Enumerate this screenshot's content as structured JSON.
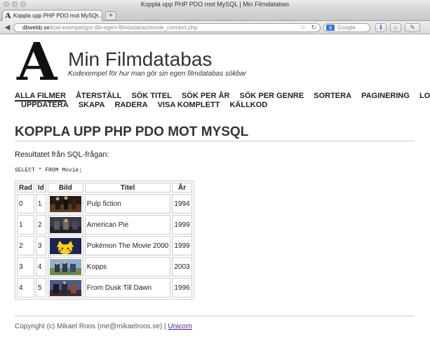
{
  "window": {
    "title": "Koppla upp PHP PDO mot MySQL | Min Filmdatabas"
  },
  "tab": {
    "label": "Koppla upp PHP PDO mot MySQ...",
    "close": "×",
    "new_tab": "+"
  },
  "toolbar": {
    "back": "◀",
    "url_domain": "dbwebb.se",
    "url_path": "/kod-exempel/gor-din-egen-filmdatabas/movie_connect.php",
    "bookmark_star": "☆",
    "reload": "↻",
    "search_engine": "g",
    "search_placeholder": "Google",
    "download": "⬇",
    "home": "⌂",
    "tools": "✎"
  },
  "site": {
    "logo_letter": "A",
    "title": "Min Filmdatabas",
    "slogan": "Kodexempel för hur man gör sin egen filmdatabas sökbar"
  },
  "menu": {
    "row1": [
      "ALLA FILMER",
      "ÅTERSTÄLL",
      "SÖK TITEL",
      "SÖK PER ÅR",
      "SÖK PER GENRE",
      "SORTERA",
      "PAGINERING",
      "LOGIN"
    ],
    "row2": [
      "UPPDATERA",
      "SKAPA",
      "RADERA",
      "VISA KOMPLETT",
      "KÄLLKOD"
    ],
    "selected": "ALLA FILMER"
  },
  "main": {
    "heading": "KOPPLA UPP PHP PDO MOT MYSQL",
    "intro": "Resultatet från SQL-frågan:",
    "sql": "SELECT * FROM Movie;"
  },
  "table": {
    "headers": [
      "Rad",
      "Id",
      "Bild",
      "Titel",
      "År"
    ],
    "rows": [
      {
        "rad": "0",
        "id": "1",
        "thumb_icon": "pulp-fiction-thumb",
        "titel": "Pulp fiction",
        "ar": "1994"
      },
      {
        "rad": "1",
        "id": "2",
        "thumb_icon": "american-pie-thumb",
        "titel": "American Pie",
        "ar": "1999"
      },
      {
        "rad": "2",
        "id": "3",
        "thumb_icon": "pokemon-thumb",
        "titel": "Pokémon The Movie 2000",
        "ar": "1999"
      },
      {
        "rad": "3",
        "id": "4",
        "thumb_icon": "kopps-thumb",
        "titel": "Kopps",
        "ar": "2003"
      },
      {
        "rad": "4",
        "id": "5",
        "thumb_icon": "from-dusk-thumb",
        "titel": "From Dusk Till Dawn",
        "ar": "1996"
      }
    ]
  },
  "footer": {
    "text": "Copyright (c) Mikael Roos (me@mikaelroos.se) |",
    "link": "Unicorn"
  },
  "colors": {
    "link_visited": "#551a8b",
    "text": "#222222",
    "rule": "#cccccc"
  }
}
